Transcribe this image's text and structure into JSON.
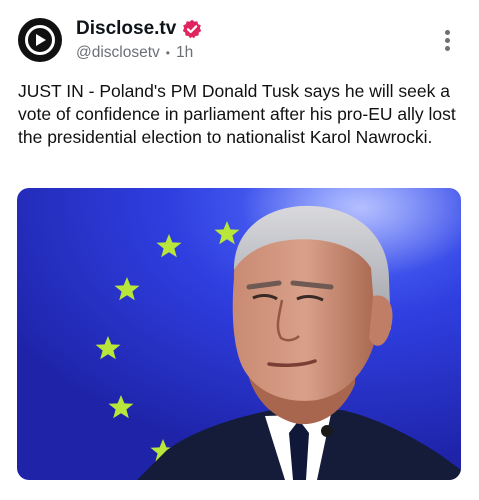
{
  "account": {
    "display_name": "Disclose.tv",
    "handle": "@disclosetv",
    "separator": "•",
    "time_ago": "1h",
    "verified": true
  },
  "post": {
    "text": "JUST IN - Poland's PM Donald Tusk says he will seek a vote of confidence in parliament after his pro-EU ally lost the presidential election to nationalist Karol Nawrocki."
  },
  "colors": {
    "badge": "#e0245e",
    "handle_gray": "#6b6f76",
    "image_bg": "#2a35c8",
    "star": "#b8e63a"
  },
  "icons": {
    "avatar": "play-logo-icon",
    "badge": "verified-badge-icon",
    "more": "more-vertical-icon"
  }
}
